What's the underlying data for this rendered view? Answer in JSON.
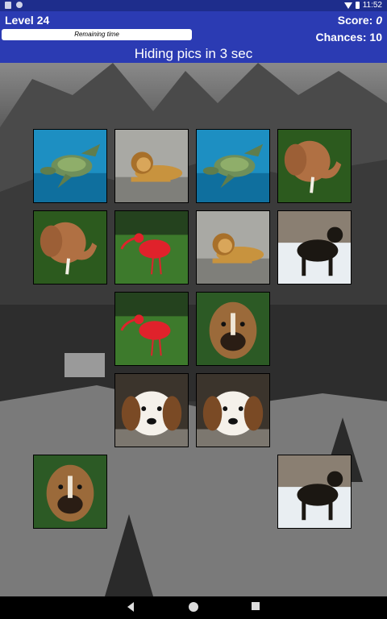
{
  "status_bar": {
    "time": "11:52"
  },
  "header": {
    "level": "Level 24",
    "score_prefix": "Score: ",
    "score_value": "0",
    "chances": "Chances: 10",
    "progress_label": "Remaining time",
    "hint": "Hiding pics in 3 sec"
  },
  "cards": [
    {
      "row": 0,
      "col": 0,
      "animal": "turtle"
    },
    {
      "row": 0,
      "col": 1,
      "animal": "lion"
    },
    {
      "row": 0,
      "col": 2,
      "animal": "turtle"
    },
    {
      "row": 0,
      "col": 3,
      "animal": "elephant"
    },
    {
      "row": 1,
      "col": 0,
      "animal": "elephant"
    },
    {
      "row": 1,
      "col": 1,
      "animal": "ibis"
    },
    {
      "row": 1,
      "col": 2,
      "animal": "lion"
    },
    {
      "row": 1,
      "col": 3,
      "animal": "rottweiler"
    },
    {
      "row": 2,
      "col": 1,
      "animal": "ibis"
    },
    {
      "row": 2,
      "col": 2,
      "animal": "boxer"
    },
    {
      "row": 3,
      "col": 1,
      "animal": "beagle"
    },
    {
      "row": 3,
      "col": 2,
      "animal": "beagle"
    },
    {
      "row": 4,
      "col": 0,
      "animal": "boxer"
    },
    {
      "row": 4,
      "col": 3,
      "animal": "rottweiler"
    }
  ],
  "nav": {
    "back_icon": "back-triangle-icon",
    "home_icon": "home-circle-icon",
    "recent_icon": "recents-square-icon"
  }
}
